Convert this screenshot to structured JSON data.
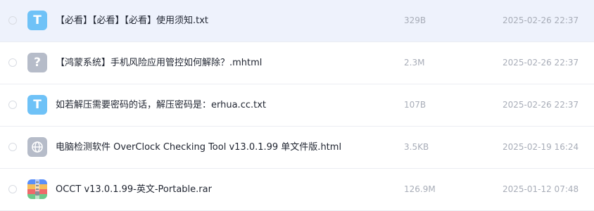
{
  "files": [
    {
      "name": "【必看】【必看】【必看】使用须知.txt",
      "size": "329B",
      "date": "2025-02-26 22:37",
      "icon": "txt-file-icon",
      "icon_glyph": "T"
    },
    {
      "name": "【鸿蒙系统】手机风险应用管控如何解除？.mhtml",
      "size": "2.3M",
      "date": "2025-02-26 22:37",
      "icon": "unknown-file-icon",
      "icon_glyph": "?"
    },
    {
      "name": "如若解压需要密码的话，解压密码是：erhua.cc.txt",
      "size": "107B",
      "date": "2025-02-26 22:37",
      "icon": "txt-file-icon",
      "icon_glyph": "T"
    },
    {
      "name": "电脑检测软件 OverClock Checking Tool v13.0.1.99 单文件版.html",
      "size": "3.5KB",
      "date": "2025-02-19 16:24",
      "icon": "web-file-icon"
    },
    {
      "name": "OCCT v13.0.1.99-英文-Portable.rar",
      "size": "126.9M",
      "date": "2025-01-12 07:48",
      "icon": "archive-file-icon"
    }
  ],
  "colors": {
    "selected_row_bg": "#eef2fc",
    "txt_icon": "#6fc2f7",
    "generic_icon": "#b6bcc9",
    "meta_text": "#a8adb8",
    "name_text": "#1f2430"
  }
}
